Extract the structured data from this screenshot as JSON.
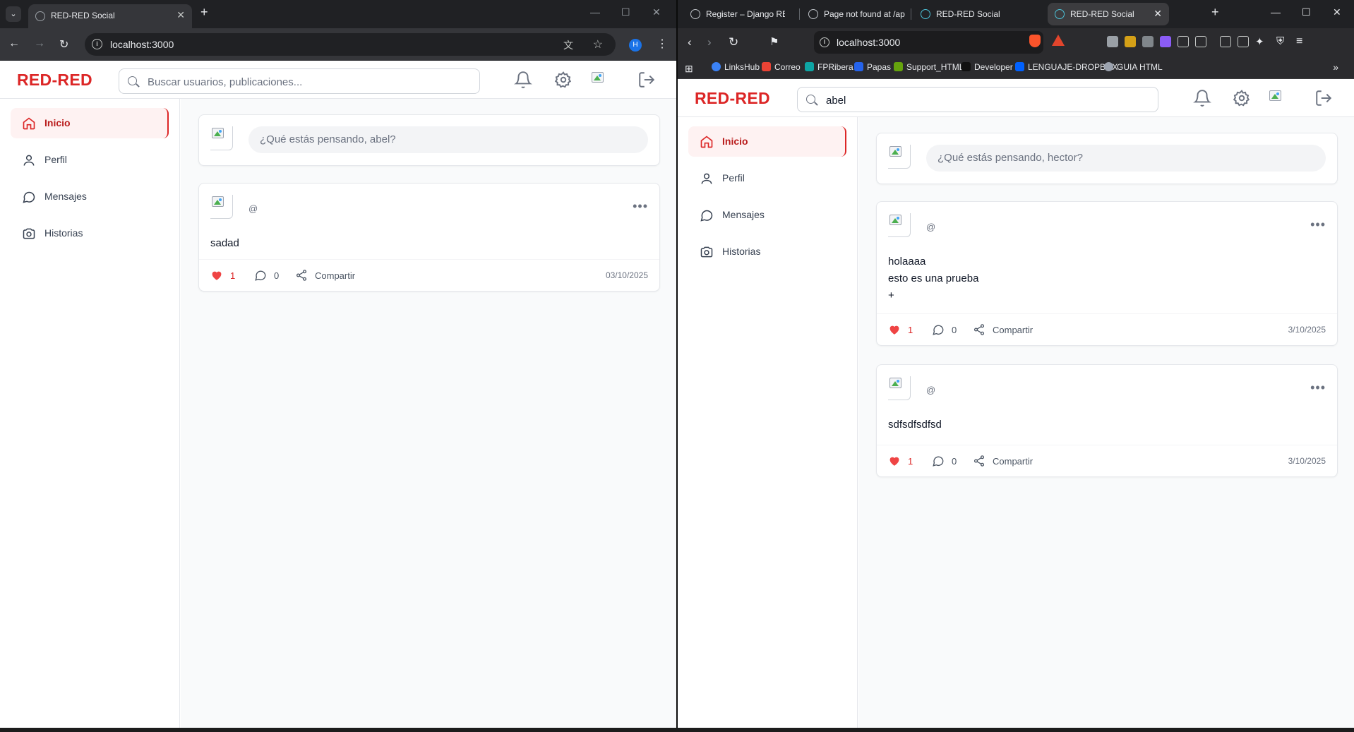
{
  "left_browser": {
    "tab_title": "RED-RED Social",
    "url": "localhost:3000",
    "profile_initial": "H"
  },
  "right_browser": {
    "tabs": [
      {
        "title": "Register – Django REST fr"
      },
      {
        "title": "Page not found at /api/ch"
      },
      {
        "title": "RED-RED Social"
      },
      {
        "title": "RED-RED Social"
      }
    ],
    "url": "localhost:3000",
    "bookmarks": [
      "LinksHub",
      "Correo",
      "FPRibera",
      "Papas",
      "Support_HTML",
      "Developer",
      "LENGUAJE-DROPBOX",
      "GUIA HTML"
    ]
  },
  "left_app": {
    "logo": "RED-RED",
    "search": {
      "placeholder": "Buscar usuarios, publicaciones...",
      "value": ""
    },
    "nav": [
      {
        "label": "Inicio",
        "icon": "home-icon",
        "active": true
      },
      {
        "label": "Perfil",
        "icon": "user-icon"
      },
      {
        "label": "Mensajes",
        "icon": "message-icon"
      },
      {
        "label": "Historias",
        "icon": "camera-icon"
      }
    ],
    "composer_prompt": "¿Qué estás pensando, abel?",
    "posts": [
      {
        "handle": "@",
        "body": [
          "sadad"
        ],
        "likes": "1",
        "comments": "0",
        "share": "Compartir",
        "date": "03/10/2025"
      }
    ]
  },
  "right_app": {
    "logo": "RED-RED",
    "search": {
      "placeholder": "Buscar usuarios, publicaciones...",
      "value": "abel"
    },
    "nav": [
      {
        "label": "Inicio",
        "icon": "home-icon",
        "active": true
      },
      {
        "label": "Perfil",
        "icon": "user-icon"
      },
      {
        "label": "Mensajes",
        "icon": "message-icon"
      },
      {
        "label": "Historias",
        "icon": "camera-icon"
      }
    ],
    "composer_prompt": "¿Qué estás pensando, hector?",
    "posts": [
      {
        "handle": "@",
        "body": [
          "holaaaa",
          "esto es una prueba",
          "+"
        ],
        "likes": "1",
        "comments": "0",
        "share": "Compartir",
        "date": "3/10/2025"
      },
      {
        "handle": "@",
        "body": [
          "sdfsdfsdfsd"
        ],
        "likes": "1",
        "comments": "0",
        "share": "Compartir",
        "date": "3/10/2025"
      }
    ]
  },
  "colors": {
    "brand": "#dc2626",
    "active_bg": "#fef2f2",
    "chrome_dark": "#202124",
    "toolbar_dark": "#35363a"
  }
}
